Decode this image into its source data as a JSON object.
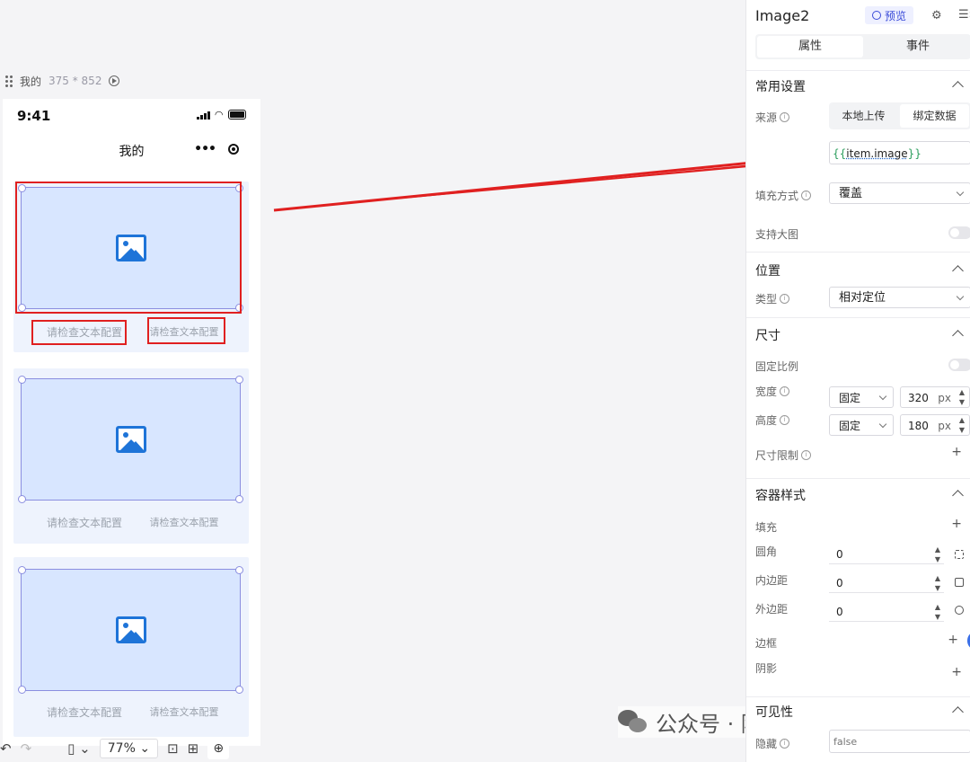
{
  "frame": {
    "name": "我的",
    "size": "375 * 852"
  },
  "phone": {
    "time": "9:41",
    "title": "我的",
    "capsule_dots": "•••",
    "cards": [
      {
        "text_left": "请检查文本配置",
        "text_right": "请检查文本配置"
      },
      {
        "text_left": "请检查文本配置",
        "text_right": "请检查文本配置"
      },
      {
        "text_left": "请检查文本配置",
        "text_right": "请检查文本配置"
      }
    ]
  },
  "toolbar": {
    "undo": "↶",
    "redo": "↷",
    "zoom": "77%"
  },
  "panel": {
    "title": "Image2",
    "preview": "预览",
    "tabs": [
      "属性",
      "事件"
    ],
    "common": {
      "heading": "常用设置",
      "source_label": "来源",
      "source_options": [
        "本地上传",
        "绑定数据"
      ],
      "binding_prefix": "{{",
      "binding_value": "item.image",
      "binding_suffix": "}}",
      "fill_label": "填充方式",
      "fill_value": "覆盖",
      "big_image_label": "支持大图"
    },
    "position": {
      "heading": "位置",
      "type_label": "类型",
      "type_value": "相对定位"
    },
    "size": {
      "heading": "尺寸",
      "fixed_ratio_label": "固定比例",
      "width_label": "宽度",
      "width_mode": "固定",
      "width_value": "320",
      "height_label": "高度",
      "height_mode": "固定",
      "height_value": "180",
      "unit": "px",
      "limit_label": "尺寸限制"
    },
    "container": {
      "heading": "容器样式",
      "fill_label": "填充",
      "radius_label": "圆角",
      "radius_value": "0",
      "padding_label": "内边距",
      "padding_value": "0",
      "margin_label": "外边距",
      "margin_value": "0",
      "border_label": "边框",
      "shadow_label": "阴影"
    },
    "visibility": {
      "heading": "可见性",
      "hide_label": "隐藏",
      "hide_placeholder": "false"
    }
  },
  "watermark": "公众号 · 阿康的AI助手",
  "colors": {
    "highlight": "#e02020",
    "image_fill": "#d8e6ff",
    "accent": "#3a4bd8"
  }
}
